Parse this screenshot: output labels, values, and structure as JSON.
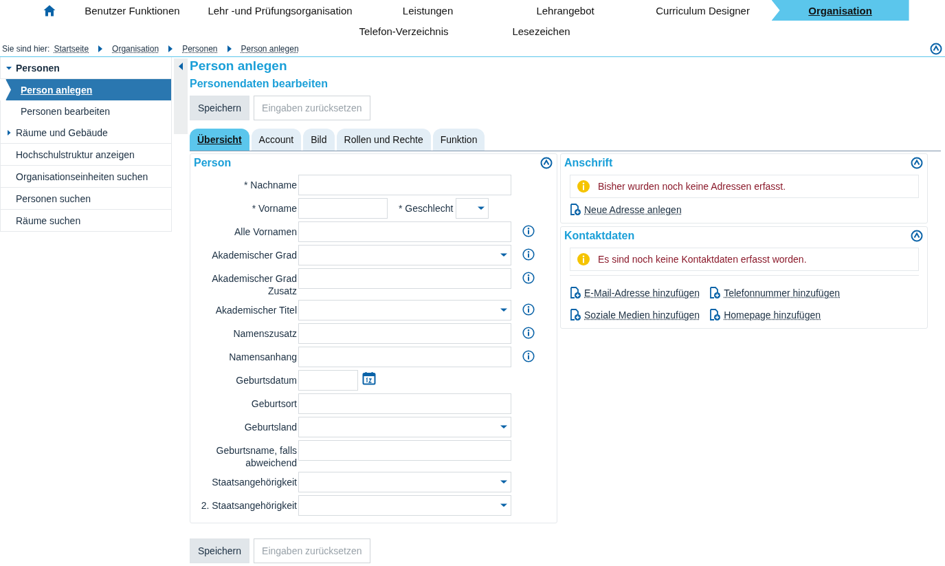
{
  "nav": {
    "rows": [
      {
        "items": [
          {
            "label": "Benutzer Funktionen",
            "selected": false
          },
          {
            "label": "Lehr -und Prüfungsorganisation",
            "selected": false
          },
          {
            "label": "Leistungen",
            "selected": false
          },
          {
            "label": "Lehrangebot",
            "selected": false
          },
          {
            "label": "Curriculum Designer",
            "selected": false
          },
          {
            "label": "Organisation",
            "selected": true
          }
        ]
      },
      {
        "items": [
          {
            "label": "Telefon-Verzeichnis",
            "selected": false
          },
          {
            "label": "Lesezeichen",
            "selected": false
          }
        ]
      }
    ]
  },
  "breadcrumb": {
    "prefix": "Sie sind hier:",
    "items": [
      "Startseite",
      "Organisation",
      "Personen",
      "Person anlegen"
    ]
  },
  "sidebar": {
    "items": [
      {
        "label": "Personen",
        "expanded": true,
        "children": [
          {
            "label": "Person anlegen",
            "selected": true
          },
          {
            "label": "Personen bearbeiten",
            "selected": false
          }
        ]
      },
      {
        "label": "Räume und Gebäude",
        "expanded": false
      },
      {
        "label": "Hochschulstruktur anzeigen"
      },
      {
        "label": "Organisationseinheiten suchen"
      },
      {
        "label": "Personen suchen"
      },
      {
        "label": "Räume suchen"
      }
    ]
  },
  "page": {
    "title": "Person anlegen",
    "subtitle": "Personendaten bearbeiten"
  },
  "buttons_top": [
    {
      "label": "Speichern",
      "disabled": false
    },
    {
      "label": "Eingaben zurücksetzen",
      "disabled": true
    }
  ],
  "tabs": [
    {
      "label": "Übersicht",
      "selected": true
    },
    {
      "label": "Account",
      "selected": false
    },
    {
      "label": "Bild",
      "selected": false
    },
    {
      "label": "Rollen und Rechte",
      "selected": false
    },
    {
      "label": "Funktion",
      "selected": false
    }
  ],
  "person": {
    "title": "Person",
    "rows": [
      {
        "info": false,
        "fields": [
          {
            "label": "* Nachname",
            "kind": "text"
          }
        ]
      },
      {
        "info": false,
        "fields": [
          {
            "label": "* Vorname",
            "kind": "text"
          },
          {
            "label": "* Geschlecht",
            "kind": "select"
          }
        ]
      },
      {
        "info": true,
        "fields": [
          {
            "label": "Alle Vornamen",
            "kind": "text"
          }
        ]
      },
      {
        "info": true,
        "fields": [
          {
            "label": "Akademischer Grad",
            "kind": "select"
          }
        ]
      },
      {
        "info": true,
        "fields": [
          {
            "label": "Akademischer Grad Zusatz",
            "kind": "text"
          }
        ]
      },
      {
        "info": true,
        "fields": [
          {
            "label": "Akademischer Titel",
            "kind": "select"
          }
        ]
      },
      {
        "info": true,
        "fields": [
          {
            "label": "Namenszusatz",
            "kind": "text"
          }
        ]
      },
      {
        "info": true,
        "fields": [
          {
            "label": "Namensanhang",
            "kind": "text"
          }
        ]
      },
      {
        "info": false,
        "fields": [
          {
            "label": "Geburtsdatum",
            "kind": "date"
          }
        ]
      },
      {
        "info": false,
        "fields": [
          {
            "label": "Geburtsort",
            "kind": "text"
          }
        ]
      },
      {
        "info": false,
        "fields": [
          {
            "label": "Geburtsland",
            "kind": "select"
          }
        ]
      },
      {
        "info": false,
        "fields": [
          {
            "label": "Geburtsname, falls abweichend",
            "kind": "text"
          }
        ]
      },
      {
        "info": false,
        "fields": [
          {
            "label": "Staatsangehörigkeit",
            "kind": "select"
          }
        ]
      },
      {
        "info": false,
        "fields": [
          {
            "label": "2. Staatsangehörigkeit",
            "kind": "select"
          }
        ]
      }
    ]
  },
  "anschrift": {
    "title": "Anschrift",
    "message": "Bisher wurden noch keine Adressen erfasst.",
    "links": [
      "Neue Adresse anlegen"
    ]
  },
  "kontaktdaten": {
    "title": "Kontaktdaten",
    "message": "Es sind noch keine Kontaktdaten erfasst worden.",
    "links": [
      "E-Mail-Adresse hinzufügen",
      "Telefonnummer hinzufügen",
      "Soziale Medien hinzufügen",
      "Homepage hinzufügen"
    ]
  },
  "buttons_bottom": [
    {
      "label": "Speichern",
      "disabled": false
    },
    {
      "label": "Eingaben zurücksetzen",
      "disabled": true
    }
  ]
}
